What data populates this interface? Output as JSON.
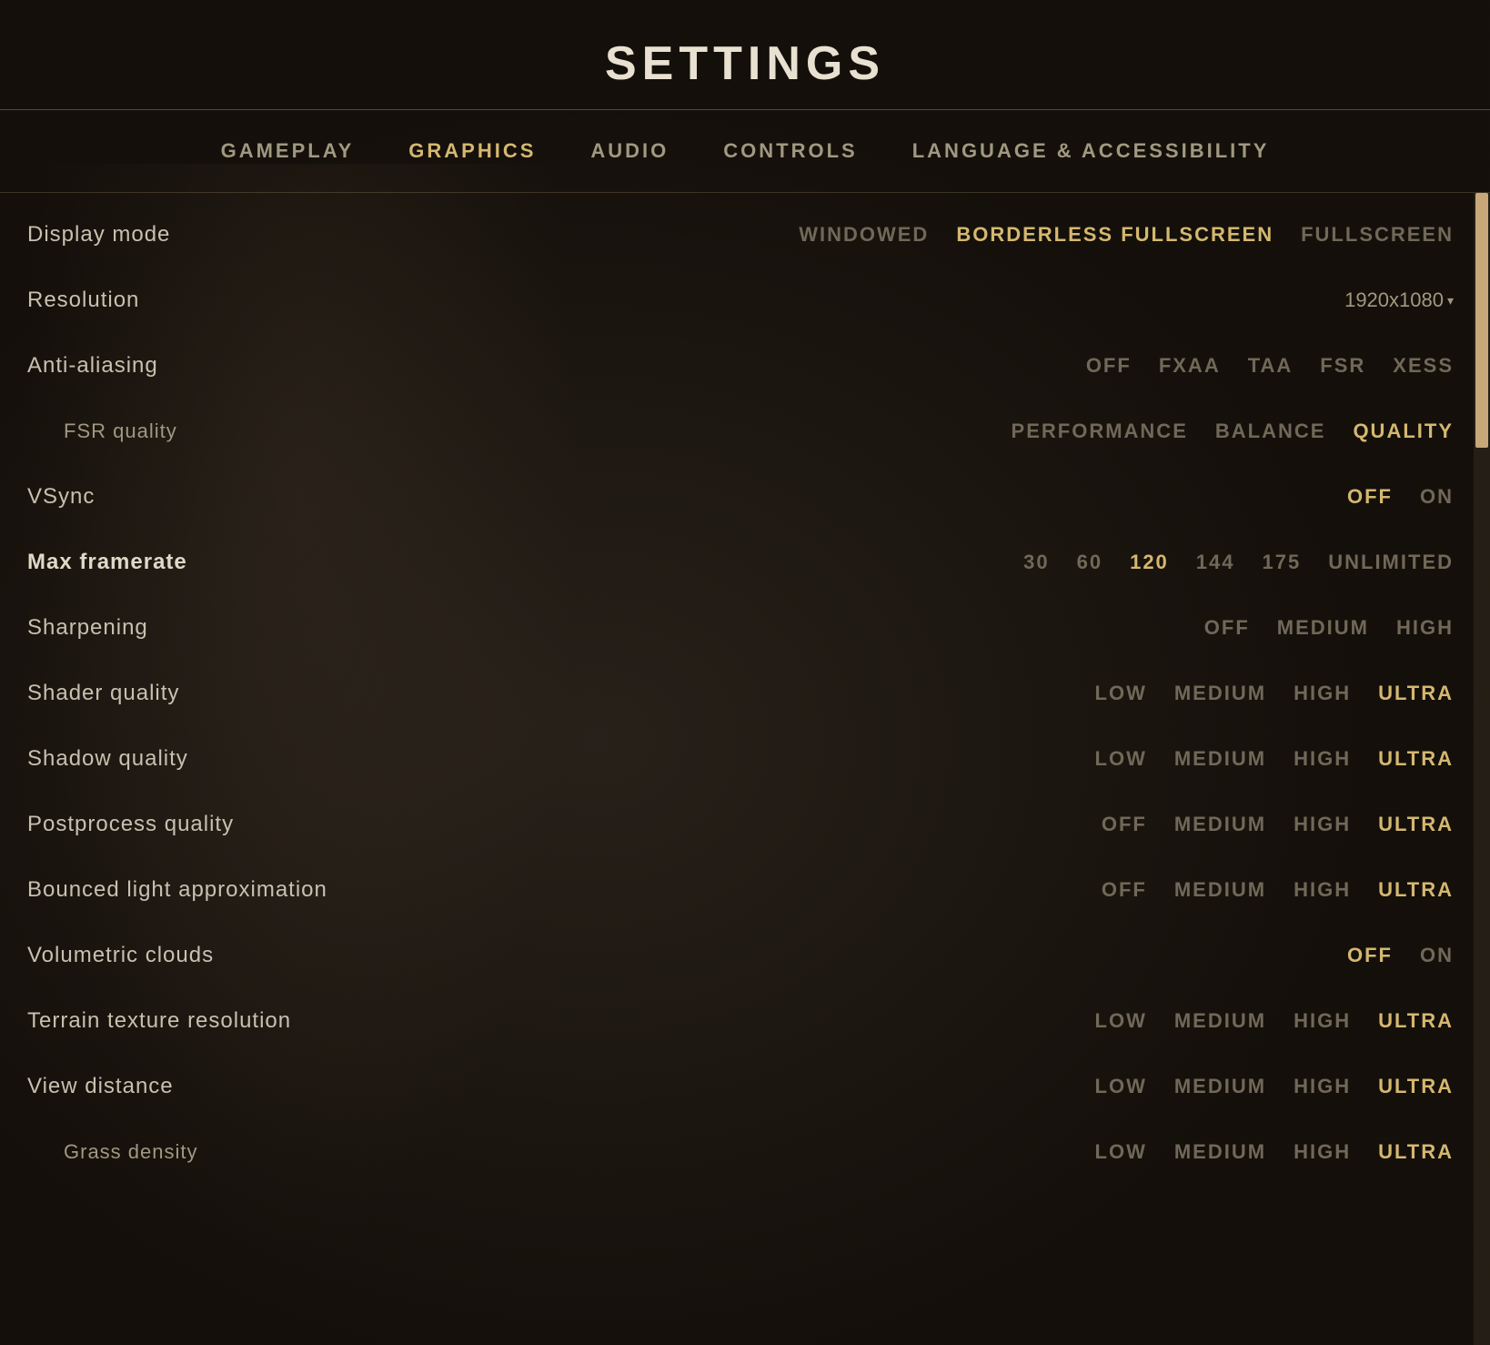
{
  "title": "SETTINGS",
  "nav": {
    "tabs": [
      {
        "id": "gameplay",
        "label": "GAMEPLAY",
        "active": false
      },
      {
        "id": "graphics",
        "label": "GRAPHICS",
        "active": true
      },
      {
        "id": "audio",
        "label": "AUDIO",
        "active": false
      },
      {
        "id": "controls",
        "label": "CONTROLS",
        "active": false
      },
      {
        "id": "language",
        "label": "LANGUAGE & ACCESSIBILITY",
        "active": false
      }
    ]
  },
  "settings": [
    {
      "id": "display-mode",
      "label": "Display mode",
      "bold": false,
      "indented": false,
      "options": [
        {
          "label": "WINDOWED",
          "active": false
        },
        {
          "label": "BORDERLESS FULLSCREEN",
          "active": true
        },
        {
          "label": "FULLSCREEN",
          "active": false
        }
      ],
      "type": "options"
    },
    {
      "id": "resolution",
      "label": "Resolution",
      "bold": false,
      "indented": false,
      "value": "1920x1080",
      "type": "dropdown"
    },
    {
      "id": "anti-aliasing",
      "label": "Anti-aliasing",
      "bold": false,
      "indented": false,
      "options": [
        {
          "label": "OFF",
          "active": false
        },
        {
          "label": "FXAA",
          "active": false
        },
        {
          "label": "TAA",
          "active": false
        },
        {
          "label": "FSR",
          "active": false
        },
        {
          "label": "XESS",
          "active": false
        }
      ],
      "type": "options"
    },
    {
      "id": "fsr-quality",
      "label": "FSR quality",
      "bold": false,
      "indented": true,
      "options": [
        {
          "label": "PERFORMANCE",
          "active": false
        },
        {
          "label": "BALANCE",
          "active": false
        },
        {
          "label": "QUALITY",
          "active": true
        }
      ],
      "type": "options"
    },
    {
      "id": "vsync",
      "label": "VSync",
      "bold": false,
      "indented": false,
      "options": [
        {
          "label": "OFF",
          "active": true
        },
        {
          "label": "ON",
          "active": false
        }
      ],
      "type": "options"
    },
    {
      "id": "max-framerate",
      "label": "Max framerate",
      "bold": true,
      "indented": false,
      "options": [
        {
          "label": "30",
          "active": false
        },
        {
          "label": "60",
          "active": false
        },
        {
          "label": "120",
          "active": true
        },
        {
          "label": "144",
          "active": false
        },
        {
          "label": "175",
          "active": false
        },
        {
          "label": "UNLIMITED",
          "active": false
        }
      ],
      "type": "options"
    },
    {
      "id": "sharpening",
      "label": "Sharpening",
      "bold": false,
      "indented": false,
      "options": [
        {
          "label": "OFF",
          "active": false
        },
        {
          "label": "MEDIUM",
          "active": false
        },
        {
          "label": "HIGH",
          "active": false
        }
      ],
      "type": "options"
    },
    {
      "id": "shader-quality",
      "label": "Shader quality",
      "bold": false,
      "indented": false,
      "options": [
        {
          "label": "LOW",
          "active": false
        },
        {
          "label": "MEDIUM",
          "active": false
        },
        {
          "label": "HIGH",
          "active": false
        },
        {
          "label": "ULTRA",
          "active": true
        }
      ],
      "type": "options"
    },
    {
      "id": "shadow-quality",
      "label": "Shadow quality",
      "bold": false,
      "indented": false,
      "options": [
        {
          "label": "LOW",
          "active": false
        },
        {
          "label": "MEDIUM",
          "active": false
        },
        {
          "label": "HIGH",
          "active": false
        },
        {
          "label": "ULTRA",
          "active": true
        }
      ],
      "type": "options"
    },
    {
      "id": "postprocess-quality",
      "label": "Postprocess quality",
      "bold": false,
      "indented": false,
      "options": [
        {
          "label": "OFF",
          "active": false
        },
        {
          "label": "MEDIUM",
          "active": false
        },
        {
          "label": "HIGH",
          "active": false
        },
        {
          "label": "ULTRA",
          "active": true
        }
      ],
      "type": "options"
    },
    {
      "id": "bounced-light",
      "label": "Bounced light approximation",
      "bold": false,
      "indented": false,
      "options": [
        {
          "label": "OFF",
          "active": false
        },
        {
          "label": "MEDIUM",
          "active": false
        },
        {
          "label": "HIGH",
          "active": false
        },
        {
          "label": "ULTRA",
          "active": true
        }
      ],
      "type": "options"
    },
    {
      "id": "volumetric-clouds",
      "label": "Volumetric clouds",
      "bold": false,
      "indented": false,
      "options": [
        {
          "label": "OFF",
          "active": true
        },
        {
          "label": "ON",
          "active": false
        }
      ],
      "type": "options"
    },
    {
      "id": "terrain-texture",
      "label": "Terrain texture resolution",
      "bold": false,
      "indented": false,
      "options": [
        {
          "label": "LOW",
          "active": false
        },
        {
          "label": "MEDIUM",
          "active": false
        },
        {
          "label": "HIGH",
          "active": false
        },
        {
          "label": "ULTRA",
          "active": true
        }
      ],
      "type": "options"
    },
    {
      "id": "view-distance",
      "label": "View distance",
      "bold": false,
      "indented": false,
      "options": [
        {
          "label": "LOW",
          "active": false
        },
        {
          "label": "MEDIUM",
          "active": false
        },
        {
          "label": "HIGH",
          "active": false
        },
        {
          "label": "ULTRA",
          "active": true
        }
      ],
      "type": "options"
    },
    {
      "id": "grass-density",
      "label": "Grass density",
      "bold": false,
      "indented": true,
      "options": [
        {
          "label": "LOW",
          "active": false
        },
        {
          "label": "MEDIUM",
          "active": false
        },
        {
          "label": "HIGH",
          "active": false
        },
        {
          "label": "ULTRA",
          "active": true
        }
      ],
      "type": "options"
    }
  ],
  "colors": {
    "active": "#d4b870",
    "inactive": "#706858",
    "text": "#c8c0b0"
  }
}
